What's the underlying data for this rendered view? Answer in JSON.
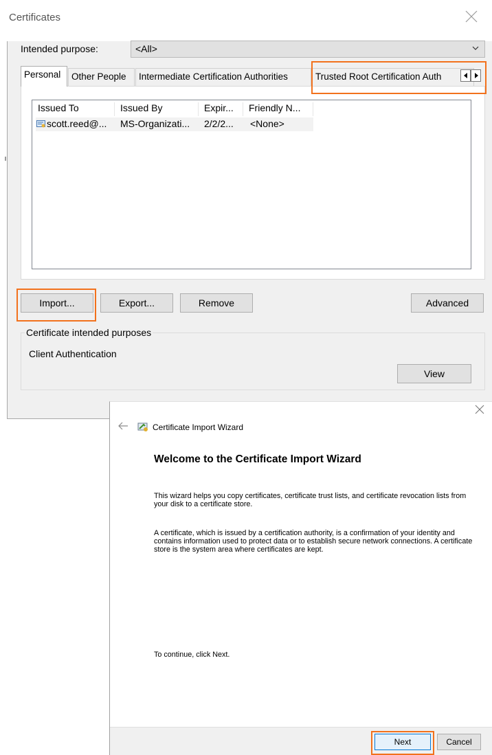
{
  "certificates_dialog": {
    "title": "Certificates",
    "intended_purpose_label": "Intended purpose:",
    "intended_purpose_value": "<All>",
    "tabs": [
      {
        "label": "Personal",
        "selected": true
      },
      {
        "label": "Other People"
      },
      {
        "label": "Intermediate Certification Authorities"
      },
      {
        "label": "Trusted Root Certification Auth"
      }
    ],
    "columns": [
      "Issued To",
      "Issued By",
      "Expir...",
      "Friendly N..."
    ],
    "rows": [
      {
        "issued_to": "scott.reed@...",
        "issued_by": "MS-Organizati...",
        "expiration": "2/2/2...",
        "friendly_name": "<None>"
      }
    ],
    "buttons": {
      "import": "Import...",
      "export": "Export...",
      "remove": "Remove",
      "advanced": "Advanced",
      "view": "View"
    },
    "purposes_group_label": "Certificate intended purposes",
    "purposes_value": "Client Authentication"
  },
  "import_wizard": {
    "title": "Certificate Import Wizard",
    "heading": "Welcome to the Certificate Import Wizard",
    "paragraph1": "This wizard helps you copy certificates, certificate trust lists, and certificate revocation lists from your disk to a certificate store.",
    "paragraph2": "A certificate, which is issued by a certification authority, is a confirmation of your identity and contains information used to protect data or to establish secure network connections. A certificate store is the system area where certificates are kept.",
    "continue_text": "To continue, click Next.",
    "buttons": {
      "next": "Next",
      "cancel": "Cancel"
    }
  },
  "colors": {
    "highlight": "#f2711c",
    "dialog_bg": "#f0f0f0",
    "button_bg": "#e1e1e1"
  },
  "icons": [
    "close-icon",
    "chevron-down-icon",
    "tab-scroll-left-icon",
    "tab-scroll-right-icon",
    "certificate-icon",
    "back-arrow-icon",
    "wizard-icon"
  ]
}
